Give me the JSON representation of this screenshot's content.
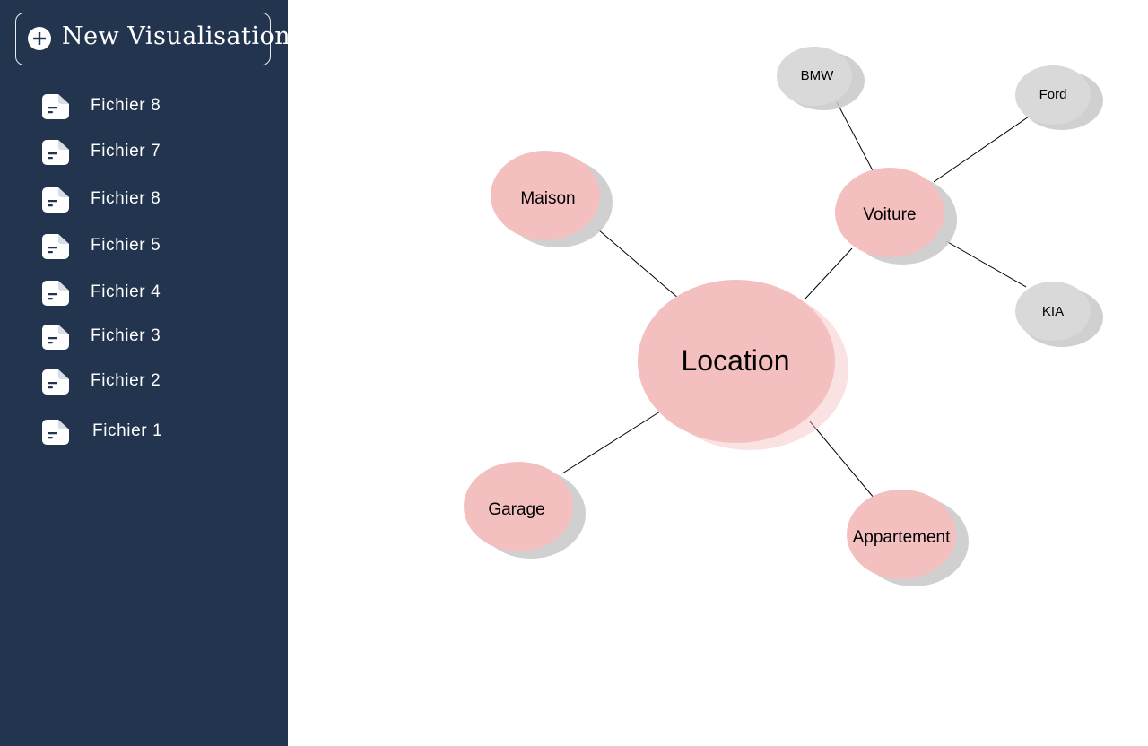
{
  "sidebar": {
    "new_button_label": "New Visualisation",
    "files": [
      {
        "label": "Fichier 8"
      },
      {
        "label": "Fichier 7"
      },
      {
        "label": "Fichier 8"
      },
      {
        "label": "Fichier 5"
      },
      {
        "label": "Fichier 4"
      },
      {
        "label": "Fichier 3"
      },
      {
        "label": "Fichier 2"
      },
      {
        "label": "Fichier 1"
      }
    ]
  },
  "mindmap": {
    "center": {
      "label": "Location"
    },
    "branches": {
      "maison": {
        "label": "Maison"
      },
      "voiture": {
        "label": "Voiture"
      },
      "garage": {
        "label": "Garage"
      },
      "appartement": {
        "label": "Appartement"
      }
    },
    "leaves": {
      "bmw": {
        "label": "BMW"
      },
      "ford": {
        "label": "Ford"
      },
      "kia": {
        "label": "KIA"
      }
    }
  },
  "colors": {
    "sidebar_bg": "#22344e",
    "node_pink": "#f4bfbf",
    "node_grey": "#d9d9d9",
    "shadow": "#c8c8c8",
    "link": "#000000"
  }
}
